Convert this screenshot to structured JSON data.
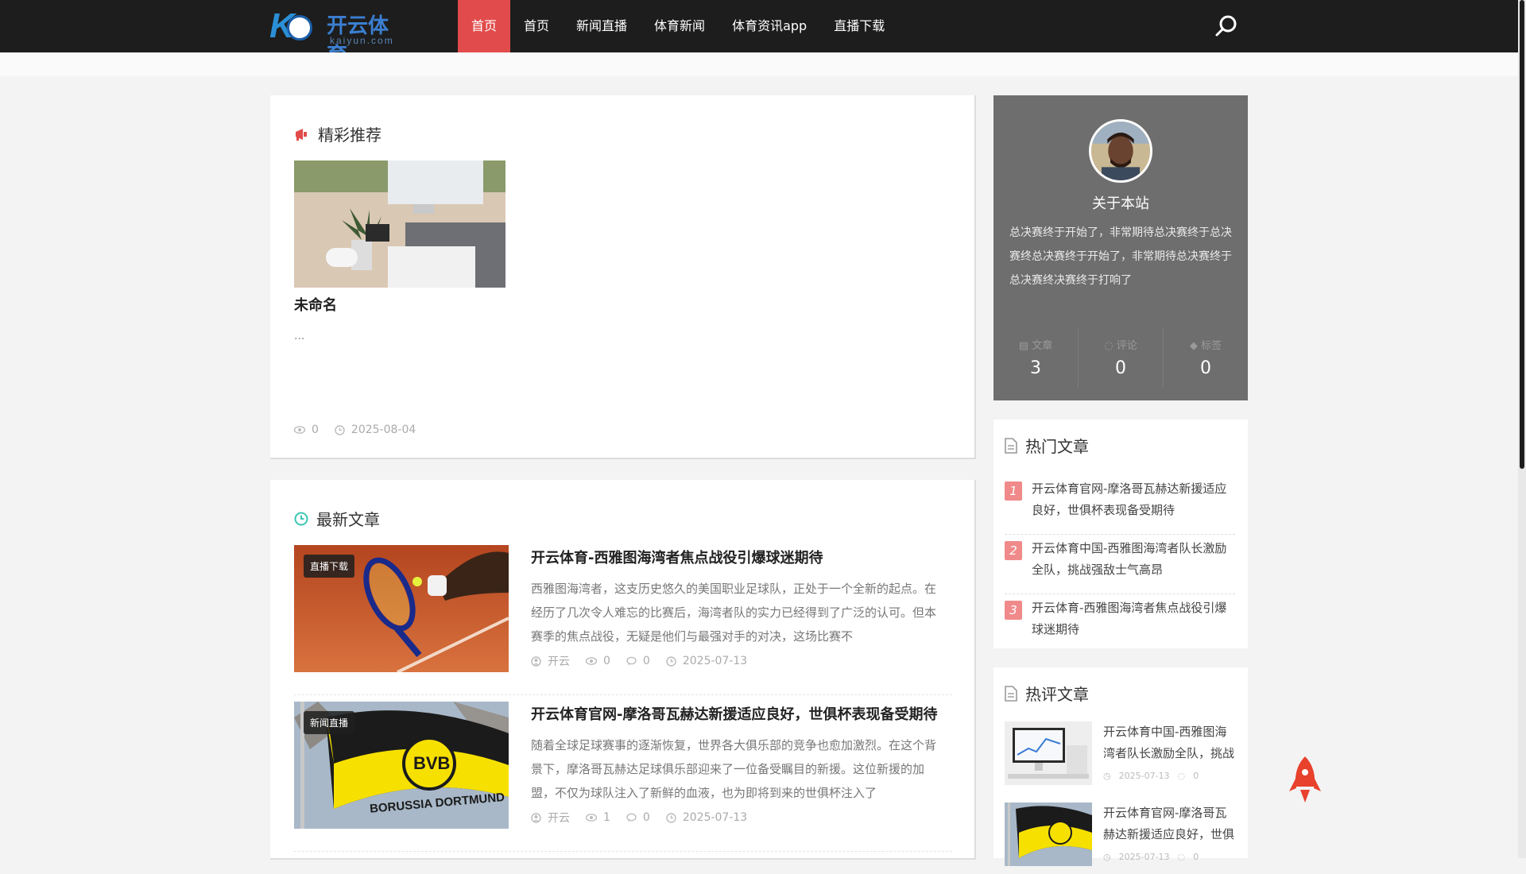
{
  "header": {
    "logo_mark": "K",
    "logo_name": "开云体育",
    "logo_domain": "kaiyun.com",
    "nav": [
      "首页",
      "首页",
      "新闻直播",
      "体育新闻",
      "体育资讯app",
      "直播下载"
    ],
    "active_index": 0
  },
  "featured": {
    "title": "精彩推荐",
    "post_title": "未命名",
    "excerpt": "...",
    "views": "0",
    "date": "2025-08-04"
  },
  "latest": {
    "title": "最新文章",
    "posts": [
      {
        "tag": "直播下载",
        "title": "开云体育-西雅图海湾者焦点战役引爆球迷期待",
        "excerpt": "西雅图海湾者，这支历史悠久的美国职业足球队，正处于一个全新的起点。在经历了几次令人难忘的比赛后，海湾者队的实力已经得到了广泛的认可。但本赛季的焦点战役，无疑是他们与最强对手的对决，这场比赛不",
        "author": "开云",
        "views": "0",
        "comments": "0",
        "date": "2025-07-13"
      },
      {
        "tag": "新闻直播",
        "title": "开云体育官网-摩洛哥瓦赫达新援适应良好，世俱杯表现备受期待",
        "excerpt": "随着全球足球赛事的逐渐恢复，世界各大俱乐部的竞争也愈加激烈。在这个背景下，摩洛哥瓦赫达足球俱乐部迎来了一位备受瞩目的新援。这位新援的加盟，不仅为球队注入了新鲜的血液，也为即将到来的世俱杯注入了",
        "author": "开云",
        "views": "1",
        "comments": "0",
        "date": "2025-07-13"
      }
    ]
  },
  "about": {
    "title": "关于本站",
    "desc": "总决赛终于开始了，非常期待总决赛终于总决赛终总决赛终于开始了，非常期待总决赛终于总决赛终决赛终于打响了",
    "stats": [
      {
        "label": "文章",
        "value": "3"
      },
      {
        "label": "评论",
        "value": "0"
      },
      {
        "label": "标签",
        "value": "0"
      }
    ]
  },
  "hot": {
    "title": "热门文章",
    "items": [
      {
        "num": "1",
        "text": "开云体育官网-摩洛哥瓦赫达新援适应良好，世俱杯表现备受期待"
      },
      {
        "num": "2",
        "text": "开云体育中国-西雅图海湾者队长激励全队，挑战强敌士气高昂"
      },
      {
        "num": "3",
        "text": "开云体育-西雅图海湾者焦点战役引爆球迷期待"
      }
    ]
  },
  "hot_comments": {
    "title": "热评文章",
    "items": [
      {
        "text": "开云体育中国-西雅图海湾者队长激励全队，挑战强敌士气高昂",
        "date": "2025-07-13",
        "comments": "0"
      },
      {
        "text": "开云体育官网-摩洛哥瓦赫达新援适应良好，世俱杯表现备受期待",
        "date": "2025-07-13",
        "comments": "0"
      }
    ]
  }
}
